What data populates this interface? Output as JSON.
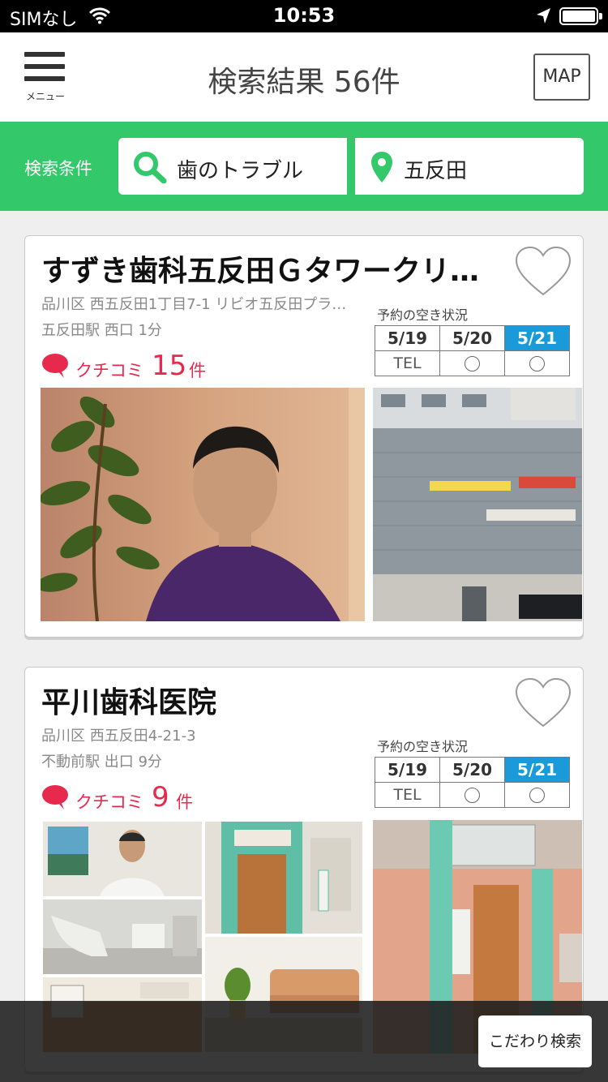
{
  "status_bar": {
    "carrier": "SIMなし",
    "time": "10:53"
  },
  "header": {
    "menu_label": "メニュー",
    "title": "検索結果 56件",
    "map_label": "MAP"
  },
  "search": {
    "conditions_label": "検索条件",
    "keyword": "歯のトラブル",
    "location": "五反田",
    "accent_color": "#33c96a"
  },
  "availability_title": "予約の空き状況",
  "clinics": [
    {
      "name": "すずき歯科五反田Ｇタワークリ…",
      "address": "品川区 西五反田1丁目7-1 リビオ五反田プラ…",
      "station": "五反田駅 西口 1分",
      "review_label": "クチコミ",
      "review_count": "15",
      "review_unit": "件",
      "dates": [
        "5/19",
        "5/20",
        "5/21"
      ],
      "slots": [
        "TEL",
        "◯",
        "◯"
      ]
    },
    {
      "name": "平川歯科医院",
      "address": "品川区 西五反田4-21-3",
      "station": "不動前駅 出口 9分",
      "review_label": "クチコミ",
      "review_count": "9",
      "review_unit": "件",
      "dates": [
        "5/19",
        "5/20",
        "5/21"
      ],
      "slots": [
        "TEL",
        "◯",
        "◯"
      ]
    }
  ],
  "bottom": {
    "filter_label": "こだわり検索"
  }
}
